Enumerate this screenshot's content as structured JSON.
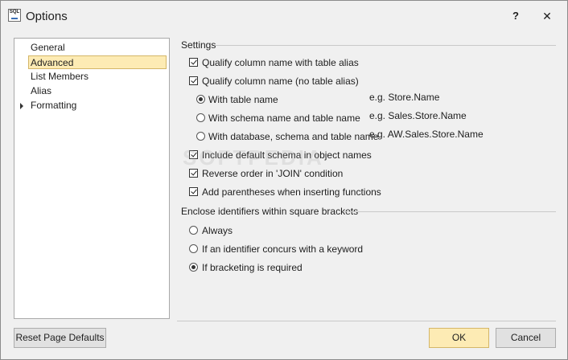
{
  "window": {
    "title": "Options",
    "app_icon_text": "SQL",
    "help_label": "?",
    "close_label": "✕"
  },
  "nav": {
    "items": [
      {
        "label": "General"
      },
      {
        "label": "Advanced"
      },
      {
        "label": "List Members"
      },
      {
        "label": "Alias"
      },
      {
        "label": "Formatting"
      }
    ],
    "selected": "Advanced"
  },
  "settings": {
    "header": "Settings",
    "qualify_alias": {
      "label": "Qualify column name with table alias",
      "checked": true
    },
    "qualify_no_alias": {
      "label": "Qualify column name (no table alias)",
      "checked": true
    },
    "naming": [
      {
        "label": "With table name",
        "example": "e.g. Store.Name",
        "selected": true
      },
      {
        "label": "With schema name and table name",
        "example": "e.g. Sales.Store.Name",
        "selected": false
      },
      {
        "label": "With database, schema and table name",
        "example": "e.g. AW.Sales.Store.Name",
        "selected": false
      }
    ],
    "include_default_schema": {
      "label": "Include default schema in object names",
      "checked": true
    },
    "reverse_order": {
      "label": "Reverse order in 'JOIN' condition",
      "checked": true
    },
    "add_parentheses": {
      "label": "Add parentheses when inserting functions",
      "checked": true
    }
  },
  "brackets": {
    "header": "Enclose identifiers within square brackets",
    "options": [
      {
        "label": "Always",
        "selected": false
      },
      {
        "label": "If an identifier concurs with a keyword",
        "selected": false
      },
      {
        "label": "If bracketing is required",
        "selected": true
      }
    ]
  },
  "footer": {
    "reset_label": "Reset Page Defaults",
    "ok_label": "OK",
    "cancel_label": "Cancel"
  },
  "watermark": "SOFTPEDIA",
  "colors": {
    "selection_bg": "#fdebb4",
    "selection_border": "#d4b668",
    "window_bg": "#f0f0f0"
  }
}
